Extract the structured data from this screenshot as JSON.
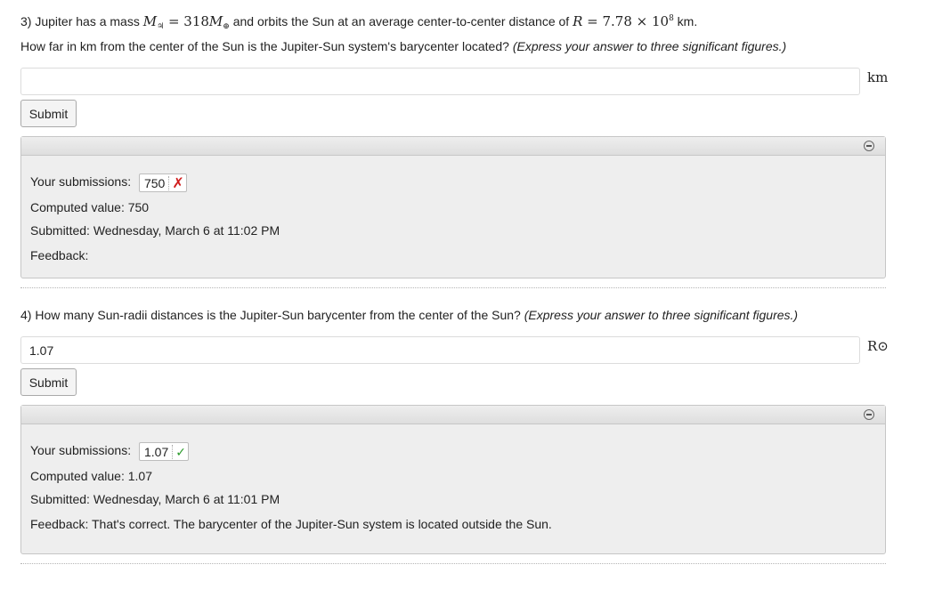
{
  "q3": {
    "prefix": "3) Jupiter has a mass ",
    "mass_symbol": "M",
    "mass_subscript": "♃",
    "mass_equals": " = 318",
    "mass_ref_symbol": "M",
    "mass_ref_subscript": "⊕",
    "middle": " and orbits the Sun at an average center-to-center distance of ",
    "r_symbol": "R",
    "r_value": " = 7.78 × 10",
    "r_exponent": "8",
    "r_unit": " km.",
    "question": "How far in km from the center of the Sun is the Jupiter-Sun system's barycenter located? ",
    "hint": "(Express your answer to three significant figures.)",
    "input_value": "",
    "unit_label": "km",
    "submit_label": "Submit",
    "result": {
      "submissions_label": "Your submissions:",
      "submission_value": "750",
      "status_mark": "✗",
      "computed_label": "Computed value: 750",
      "submitted_label": "Submitted: Wednesday, March 6 at 11:02 PM",
      "feedback_label": "Feedback:"
    }
  },
  "q4": {
    "question": "4) How many Sun-radii distances is the Jupiter-Sun barycenter from the center of the Sun? ",
    "hint": "(Express your answer to three significant figures.)",
    "input_value": "1.07",
    "unit_label": "R⊙",
    "submit_label": "Submit",
    "result": {
      "submissions_label": "Your submissions:",
      "submission_value": "1.07",
      "status_mark": "✓",
      "computed_label": "Computed value: 1.07",
      "submitted_label": "Submitted: Wednesday, March 6 at 11:01 PM",
      "feedback_label": "Feedback: That's correct. The barycenter of the Jupiter-Sun system is located outside the Sun."
    }
  },
  "icons": {
    "incorrect": "x-mark-icon",
    "correct": "checkmark-icon",
    "collapse": "collapse-minus-icon"
  },
  "colors": {
    "incorrect": "#d01d1d",
    "correct": "#2a9a2a",
    "panel_bg": "#eeeeee"
  }
}
